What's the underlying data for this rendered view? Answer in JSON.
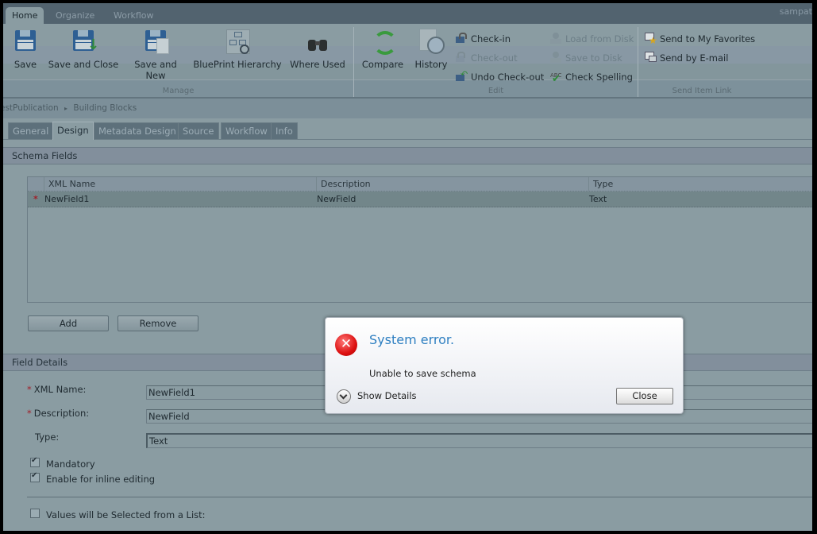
{
  "ribbon_tabs": [
    {
      "label": "Home",
      "active": true
    },
    {
      "label": "Organize",
      "active": false
    },
    {
      "label": "Workflow",
      "active": false
    }
  ],
  "user_label": "sampat",
  "groups": {
    "manage": {
      "label": "Manage",
      "buttons": [
        {
          "label": "Save",
          "icon": "save-icon"
        },
        {
          "label": "Save and Close",
          "icon": "save-close-icon"
        },
        {
          "label": "Save and",
          "label2": "New",
          "icon": "save-new-icon"
        },
        {
          "label": "BluePrint Hierarchy",
          "icon": "blueprint-hierarchy-icon"
        },
        {
          "label": "Where Used",
          "icon": "binoculars-icon"
        }
      ]
    },
    "edit": {
      "label": "Edit",
      "big_buttons": [
        {
          "label": "Compare",
          "icon": "compare-icon"
        },
        {
          "label": "History",
          "icon": "history-icon"
        }
      ],
      "small_buttons": [
        {
          "label": "Check-in",
          "enabled": true
        },
        {
          "label": "Check-out",
          "enabled": false
        },
        {
          "label": "Undo Check-out",
          "enabled": true
        },
        {
          "label": "Load from Disk",
          "enabled": false
        },
        {
          "label": "Save to Disk",
          "enabled": false
        },
        {
          "label": "Check Spelling",
          "enabled": true
        }
      ]
    },
    "send": {
      "label": "Send Item Link",
      "buttons": [
        {
          "label": "Send to My Favorites"
        },
        {
          "label": "Send by E-mail"
        }
      ]
    }
  },
  "breadcrumb": {
    "items": [
      "estPublication",
      "Building Blocks"
    ],
    "separator": "▸"
  },
  "page_tabs": [
    {
      "label": "General",
      "active": false
    },
    {
      "label": "Design",
      "active": true
    },
    {
      "label": "Metadata Design",
      "active": false
    },
    {
      "label": "Source",
      "active": false
    },
    {
      "label": "Workflow",
      "active": false
    },
    {
      "label": "Info",
      "active": false
    }
  ],
  "schema_fields": {
    "title": "Schema Fields",
    "columns": [
      "XML Name",
      "Description",
      "Type"
    ],
    "rows": [
      {
        "required": true,
        "xml_name": "NewField1",
        "description": "NewField",
        "type": "Text"
      }
    ],
    "add_label": "Add",
    "remove_label": "Remove"
  },
  "field_details": {
    "title": "Field Details",
    "xml_name_label": "XML Name:",
    "xml_name_value": "NewField1",
    "description_label": "Description:",
    "description_value": "NewField",
    "type_label": "Type:",
    "type_value": "Text",
    "mandatory_label": "Mandatory",
    "mandatory_checked": true,
    "inline_label": "Enable for inline editing",
    "inline_checked": true,
    "list_label": "Values will be Selected from a List:",
    "list_checked": false
  },
  "dialog": {
    "title": "System error.",
    "message": "Unable to save schema",
    "details_label": "Show Details",
    "close_label": "Close"
  }
}
